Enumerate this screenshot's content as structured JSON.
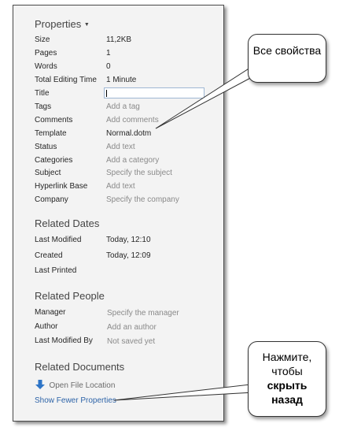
{
  "properties": {
    "header": "Properties",
    "rows": [
      {
        "label": "Size",
        "value": "11,2KB"
      },
      {
        "label": "Pages",
        "value": "1"
      },
      {
        "label": "Words",
        "value": "0"
      },
      {
        "label": "Total Editing Time",
        "value": "1 Minute"
      },
      {
        "label": "Title",
        "value": ""
      },
      {
        "label": "Tags",
        "value": "Add a tag"
      },
      {
        "label": "Comments",
        "value": "Add comments"
      },
      {
        "label": "Template",
        "value": "Normal.dotm"
      },
      {
        "label": "Status",
        "value": "Add text"
      },
      {
        "label": "Categories",
        "value": "Add a category"
      },
      {
        "label": "Subject",
        "value": "Specify the subject"
      },
      {
        "label": "Hyperlink Base",
        "value": "Add text"
      },
      {
        "label": "Company",
        "value": "Specify the company"
      }
    ]
  },
  "related_dates": {
    "header": "Related Dates",
    "rows": [
      {
        "label": "Last Modified",
        "value": "Today, 12:10"
      },
      {
        "label": "Created",
        "value": "Today, 12:09"
      },
      {
        "label": "Last Printed",
        "value": ""
      }
    ]
  },
  "related_people": {
    "header": "Related People",
    "rows": [
      {
        "label": "Manager",
        "value": "Specify the manager"
      },
      {
        "label": "Author",
        "value": "Add an author"
      },
      {
        "label": "Last Modified By",
        "value": "Not saved yet"
      }
    ]
  },
  "related_documents": {
    "header": "Related Documents",
    "open_file_location": "Open File Location",
    "show_fewer": "Show Fewer Properties"
  },
  "callout_top": {
    "text": "Все свойства"
  },
  "callout_bottom": {
    "line1": "Нажмите,",
    "line2": "чтобы",
    "line3": "скрыть назад"
  },
  "colors": {
    "link": "#2e64a8",
    "placeholder": "#8a8a8a",
    "folder_arrow": "#2e75c7"
  }
}
